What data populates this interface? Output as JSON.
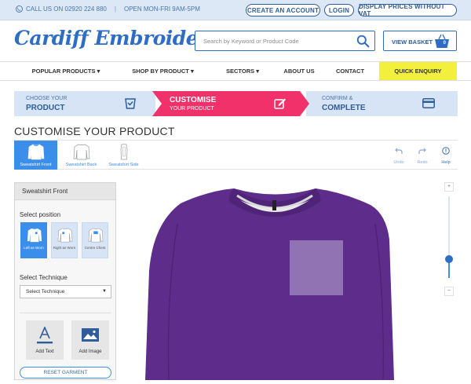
{
  "topbar": {
    "phone_text": "CALL US ON 02920 224 880",
    "separator": "|",
    "hours_text": "OPEN MON-FRI 9AM-5PM",
    "create_account": "CREATE AN ACCOUNT",
    "login": "LOGIN",
    "vat_toggle": "DISPLAY PRICES WITHOUT VAT"
  },
  "header": {
    "logo": "Cardiff Embroidery",
    "search_placeholder": "Search by Keyword or Product Code",
    "basket_label": "VIEW BASKET",
    "basket_count": "0"
  },
  "nav": {
    "items": [
      "POPULAR PRODUCTS ▾",
      "SHOP BY PRODUCT ▾",
      "SECTORS ▾",
      "ABOUT US",
      "CONTACT"
    ],
    "quick": "QUICK ENQUIRY"
  },
  "steps": [
    {
      "small": "CHOOSE YOUR",
      "big": "PRODUCT"
    },
    {
      "small": "YOUR PRODUCT",
      "big": "CUSTOMISE"
    },
    {
      "small": "CONFIRM &",
      "big": "COMPLETE"
    }
  ],
  "page_title": "CUSTOMISE YOUR PRODUCT",
  "views": [
    "Sweatshirt Front",
    "Sweatshirt Back",
    "Sweatshirt Side"
  ],
  "tools": [
    "Undo",
    "Redo",
    "Help"
  ],
  "panel": {
    "title": "Sweatshirt Front",
    "position_label": "Select position",
    "positions": [
      "Left as Worn",
      "Right as Worn",
      "Centre Chest"
    ],
    "technique_label": "Select Technique",
    "technique_value": "Select Technique",
    "add_text": "Add Text",
    "add_image": "Add Image",
    "reset": "RESET GARMENT"
  },
  "zoom": {
    "plus": "+",
    "minus": "−",
    "level": 0.25
  },
  "colors": {
    "accent": "#3b8eea",
    "brand": "#2f6dc5",
    "step_active": "#f0316a",
    "garment": "#5e2d8c",
    "quick_enquiry": "#f3f03d"
  }
}
